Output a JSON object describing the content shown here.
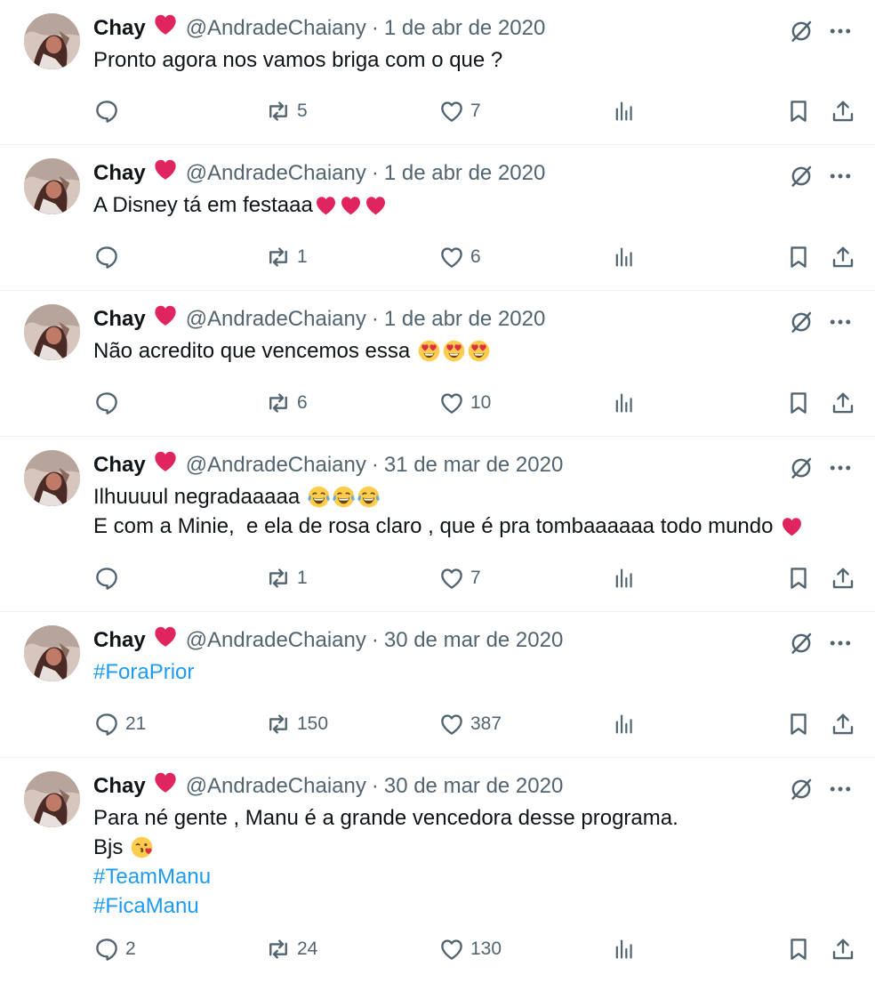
{
  "colors": {
    "text": "#0f1419",
    "muted": "#536471",
    "link": "#1d9bf0",
    "heart": "#e0245e"
  },
  "tweets": [
    {
      "name": "Chay",
      "handle": "@AndradeChaiany",
      "separator": "·",
      "date": "1 de abr de 2020",
      "lines": [
        {
          "parts": [
            {
              "text": "Pronto agora nos vamos briga com o que ?"
            }
          ]
        }
      ],
      "replies": "",
      "retweets": "5",
      "likes": "7"
    },
    {
      "name": "Chay",
      "handle": "@AndradeChaiany",
      "separator": "·",
      "date": "1 de abr de 2020",
      "lines": [
        {
          "parts": [
            {
              "text": "A Disney tá em festaaa"
            },
            {
              "emoji": "red-heart"
            },
            {
              "emoji": "red-heart"
            },
            {
              "emoji": "red-heart"
            }
          ]
        }
      ],
      "replies": "",
      "retweets": "1",
      "likes": "6"
    },
    {
      "name": "Chay",
      "handle": "@AndradeChaiany",
      "separator": "·",
      "date": "1 de abr de 2020",
      "lines": [
        {
          "parts": [
            {
              "text": "Não acredito que vencemos essa "
            },
            {
              "emoji": "heart-eyes"
            },
            {
              "emoji": "heart-eyes"
            },
            {
              "emoji": "heart-eyes"
            }
          ]
        }
      ],
      "replies": "",
      "retweets": "6",
      "likes": "10"
    },
    {
      "name": "Chay",
      "handle": "@AndradeChaiany",
      "separator": "·",
      "date": "31 de mar de 2020",
      "lines": [
        {
          "parts": [
            {
              "text": "Ilhuuuul negradaaaaa "
            },
            {
              "emoji": "tears-of-joy"
            },
            {
              "emoji": "tears-of-joy"
            },
            {
              "emoji": "tears-of-joy"
            }
          ]
        },
        {
          "parts": [
            {
              "text": "E com a Minie,  e ela de rosa claro , que é pra tombaaaaaa todo mundo "
            },
            {
              "emoji": "red-heart"
            }
          ]
        }
      ],
      "replies": "",
      "retweets": "1",
      "likes": "7"
    },
    {
      "name": "Chay",
      "handle": "@AndradeChaiany",
      "separator": "·",
      "date": "30 de mar de 2020",
      "lines": [
        {
          "hashtag": true,
          "parts": [
            {
              "text": "#ForaPrior"
            }
          ]
        }
      ],
      "replies": "21",
      "retweets": "150",
      "likes": "387"
    },
    {
      "name": "Chay",
      "handle": "@AndradeChaiany",
      "separator": "·",
      "date": "30 de mar de 2020",
      "lines": [
        {
          "parts": [
            {
              "text": "Para né gente , Manu é a grande vencedora desse programa."
            }
          ]
        },
        {
          "parts": [
            {
              "text": "Bjs "
            },
            {
              "emoji": "face-blowing-kiss"
            }
          ]
        },
        {
          "hashtag": true,
          "parts": [
            {
              "text": "#TeamManu"
            }
          ]
        },
        {
          "hashtag": true,
          "parts": [
            {
              "text": "#FicaManu"
            }
          ]
        }
      ],
      "replies": "2",
      "retweets": "24",
      "likes": "130"
    }
  ]
}
